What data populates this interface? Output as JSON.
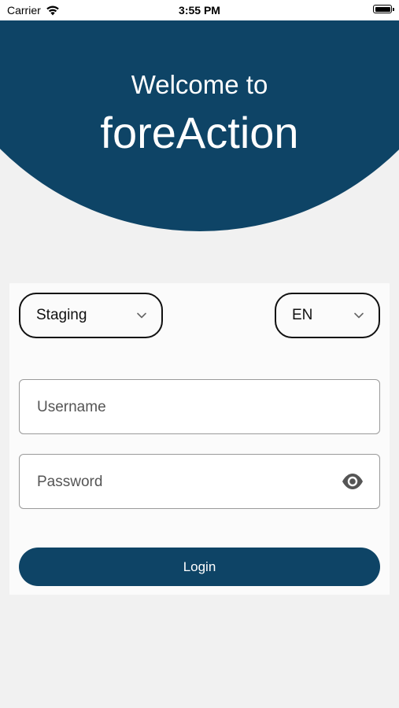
{
  "status_bar": {
    "carrier": "Carrier",
    "time": "3:55 PM",
    "icons": [
      "wifi-icon",
      "battery-icon"
    ]
  },
  "header": {
    "welcome": "Welcome to",
    "brand": "foreAction",
    "background_color": "#0e4466"
  },
  "form": {
    "environment_select": {
      "value": "Staging",
      "icon": "chevron-down-icon"
    },
    "language_select": {
      "value": "EN",
      "icon": "chevron-down-icon"
    },
    "username": {
      "placeholder": "Username",
      "value": ""
    },
    "password": {
      "placeholder": "Password",
      "value": "",
      "toggle_icon": "eye-icon"
    },
    "login_label": "Login",
    "accent_color": "#0e4466"
  }
}
